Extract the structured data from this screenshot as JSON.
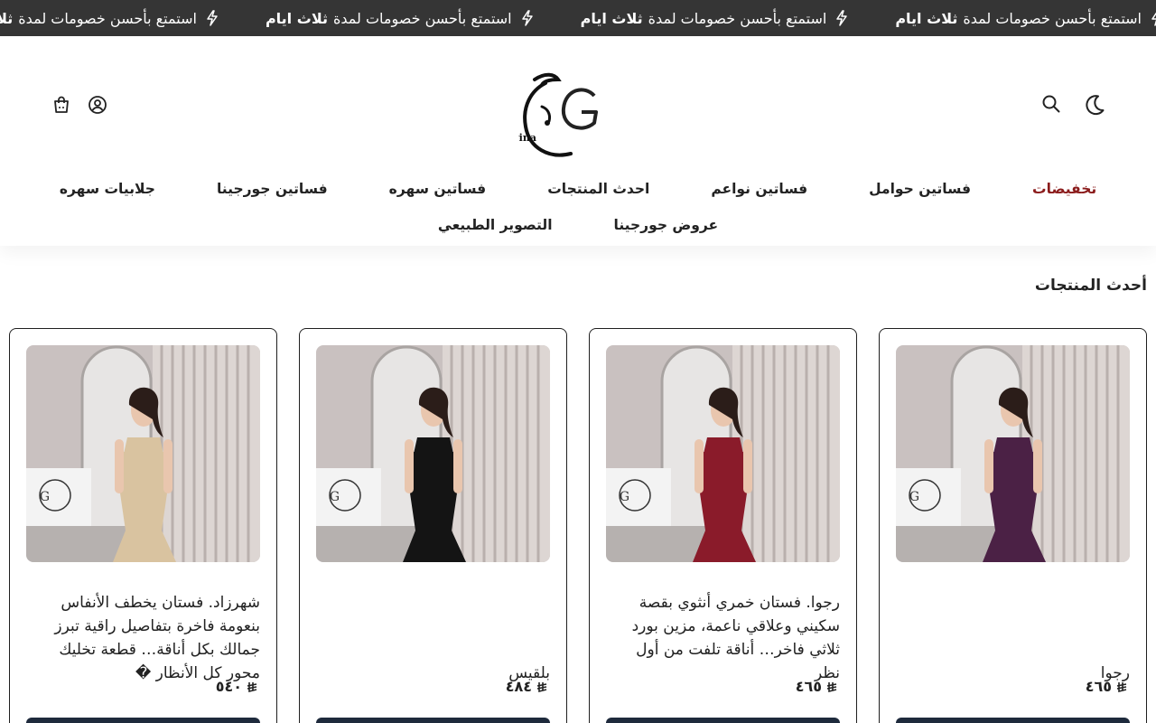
{
  "announcement": {
    "items": [
      {
        "text": "استمتع بأحسن خصومات لمدة",
        "bold": "ثلاث ايام"
      },
      {
        "text": "استمتع بأحسن خصومات لمدة",
        "bold": "ثلاث ايام"
      },
      {
        "text": "استمتع بأحسن خصومات لمدة",
        "bold": "ثلاث ايام"
      },
      {
        "text": "استمتع بأحسن خصومات لمدة",
        "bold": "ثلاث ايام"
      }
    ]
  },
  "header": {
    "logo_text": "Georgina",
    "icons": {
      "theme": "moon-icon",
      "search": "search-icon",
      "account": "user-icon",
      "cart": "shopping-bag-icon"
    }
  },
  "nav": {
    "row1": [
      "تخفيضات",
      "فساتين حوامل",
      "فساتين نواعم",
      "احدث المنتجات",
      "فساتين سهره",
      "فساتين جورجينا",
      "جلابيات سهره"
    ],
    "row2": [
      "عروض جورجينا",
      "التصوير الطبيعي"
    ]
  },
  "section": {
    "title": "أحدث المنتجات"
  },
  "products": [
    {
      "description": "رجوا",
      "price": "٤٦٥",
      "dress_color": "#4b2145"
    },
    {
      "description": "رجوا. فستان خمري أنثوي بقصة سكيني وعلاقي ناعمة، مزين بورد ثلاثي فاخر… أناقة تلفت من أول نظر",
      "price": "٤٦٥",
      "dress_color": "#8a1b2a"
    },
    {
      "description": "بلقيس",
      "price": "٤٨٤",
      "dress_color": "#141414"
    },
    {
      "description": "شهرزاد. فستان يخطف الأنفاس بنعومة فاخرة بتفاصيل راقية تبرز جمالك بكل أناقة… قطعة تخليك محور كل الأنظار �",
      "price": "٥٤٠",
      "dress_color": "#d9c3a0"
    }
  ],
  "colors": {
    "ticker_bg": "#353535",
    "sale_link": "#8b1c1c",
    "cart_button": "#1e2a3c"
  }
}
